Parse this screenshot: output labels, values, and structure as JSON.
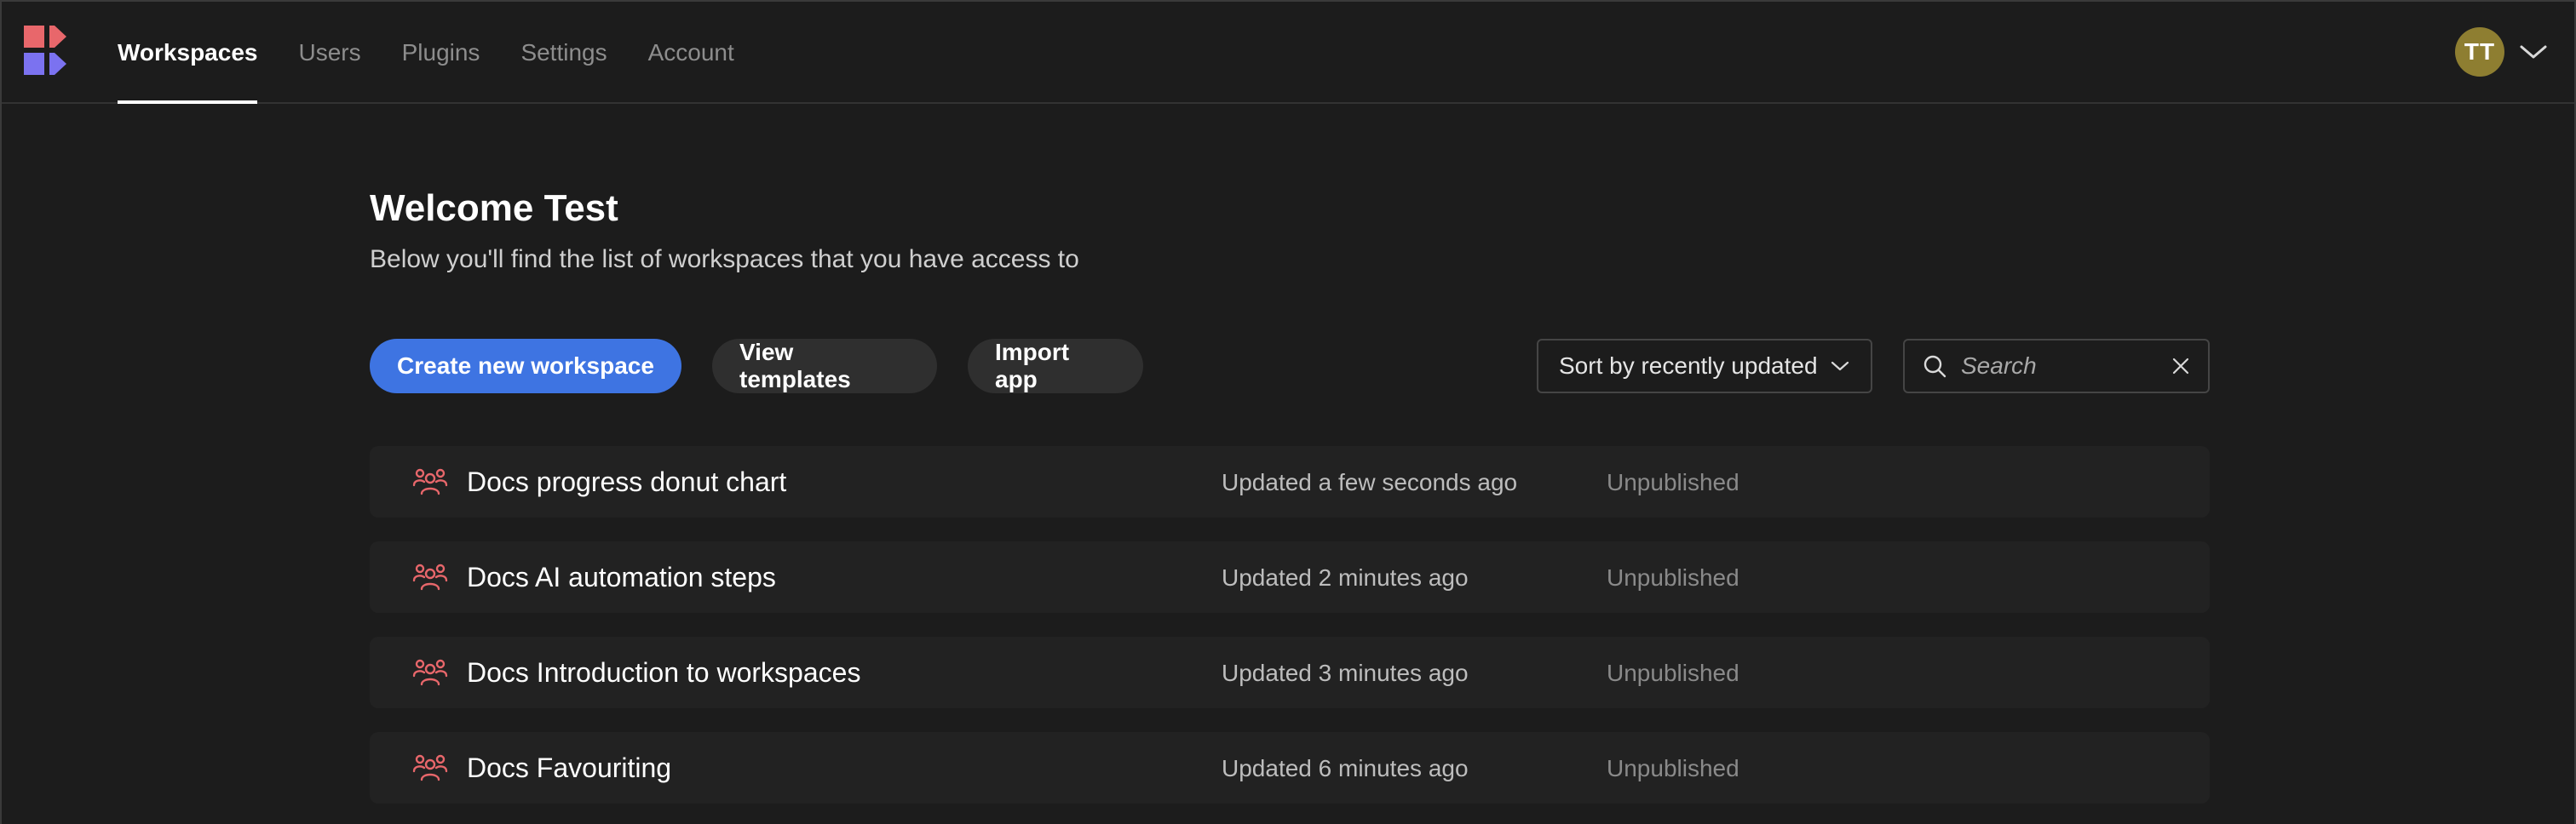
{
  "nav": {
    "tabs": [
      {
        "label": "Workspaces",
        "active": true
      },
      {
        "label": "Users",
        "active": false
      },
      {
        "label": "Plugins",
        "active": false
      },
      {
        "label": "Settings",
        "active": false
      },
      {
        "label": "Account",
        "active": false
      }
    ],
    "user_initials": "TT",
    "avatar_color": "#8e7e31"
  },
  "main": {
    "title": "Welcome Test",
    "subtitle": "Below you'll find the list of workspaces that you have access to",
    "actions": {
      "create_label": "Create new workspace",
      "templates_label": "View templates",
      "import_label": "Import app"
    },
    "sort": {
      "label": "Sort by recently updated"
    },
    "search": {
      "placeholder": "Search",
      "value": ""
    },
    "workspaces": [
      {
        "name": "Docs progress donut chart",
        "updated": "Updated a few seconds ago",
        "status": "Unpublished"
      },
      {
        "name": "Docs AI automation steps",
        "updated": "Updated 2 minutes ago",
        "status": "Unpublished"
      },
      {
        "name": "Docs Introduction to workspaces",
        "updated": "Updated 3 minutes ago",
        "status": "Unpublished"
      },
      {
        "name": "Docs Favouriting",
        "updated": "Updated 6 minutes ago",
        "status": "Unpublished"
      }
    ]
  },
  "colors": {
    "background": "#1c1c1c",
    "primary": "#3e74e2",
    "logo_red": "#e8676b",
    "logo_purple": "#7b72f0",
    "workspace_icon": "#e8676b"
  },
  "icons": {
    "logo": "budibase-logo-icon",
    "user_menu": "chevron-down-icon",
    "sort": "chevron-down-icon",
    "search": "search-icon",
    "clear": "close-icon",
    "workspace": "users-group-icon"
  }
}
